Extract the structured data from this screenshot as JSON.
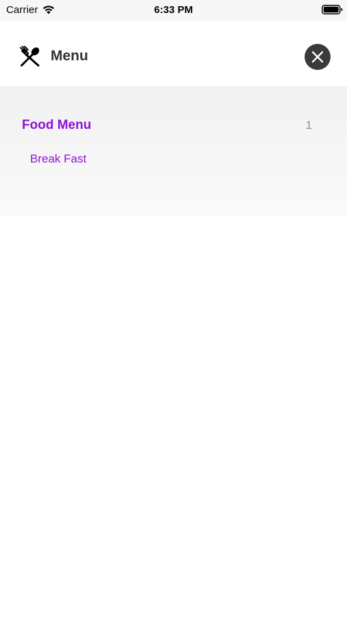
{
  "status_bar": {
    "carrier": "Carrier",
    "time": "6:33 PM",
    "wifi_icon": "wifi-icon",
    "battery_icon": "battery-icon"
  },
  "header": {
    "title": "Menu",
    "title_icon": "fork-spoon-icon",
    "close_icon": "close-icon"
  },
  "menu": {
    "sections": [
      {
        "title": "Food Menu",
        "count": "1",
        "items": [
          {
            "label": "Break Fast"
          }
        ]
      }
    ]
  },
  "colors": {
    "accent": "#9011d6",
    "header_text": "#333333",
    "close_button_bg": "#3a3a3a",
    "count_text": "#8e8e8e"
  }
}
